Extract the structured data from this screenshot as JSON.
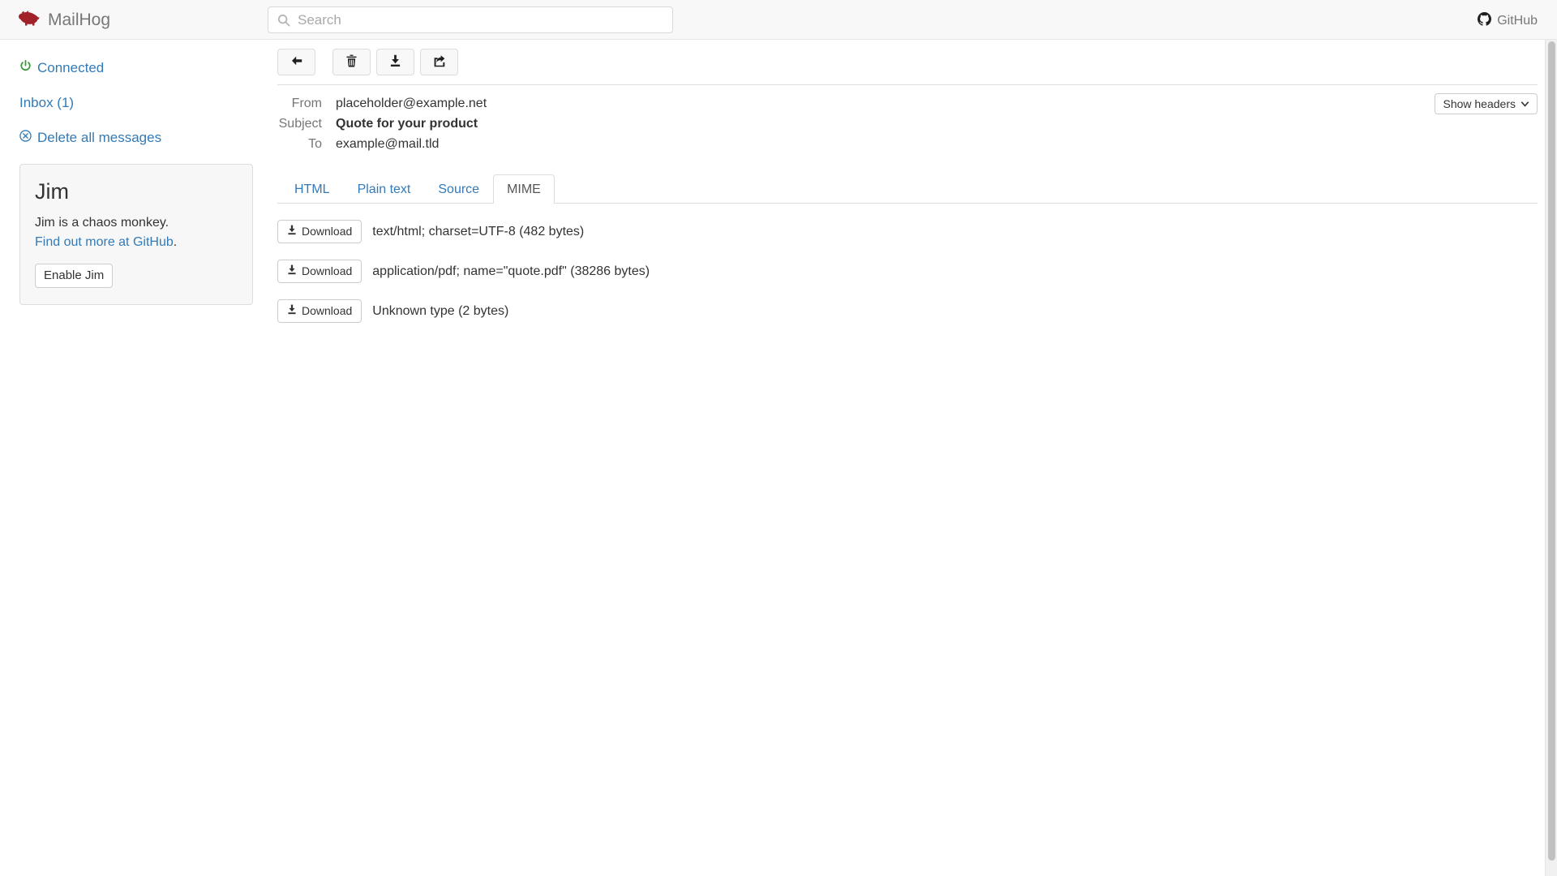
{
  "app": {
    "brand": "MailHog",
    "brand_logo_icon": "pig-icon",
    "brand_color": "#a02128"
  },
  "header": {
    "search": {
      "icon": "search-icon",
      "placeholder": "Search",
      "value": ""
    },
    "github": {
      "label": "GitHub",
      "icon": "github-icon"
    }
  },
  "sidebar": {
    "status": {
      "icon": "power-icon",
      "label": "Connected",
      "color": "#3c9a3c"
    },
    "inbox": {
      "label": "Inbox (1)"
    },
    "delete_all": {
      "icon": "x-circle-icon",
      "label": "Delete all messages"
    },
    "jim_panel": {
      "title": "Jim",
      "description": "Jim is a chaos monkey.",
      "link_label": "Find out more at GitHub",
      "link_suffix": ".",
      "button_label": "Enable Jim"
    }
  },
  "toolbar": {
    "buttons": [
      {
        "name": "back-button",
        "icon": "arrow-left-icon"
      },
      {
        "name": "delete-button",
        "icon": "trash-icon"
      },
      {
        "name": "download-button",
        "icon": "download-icon"
      },
      {
        "name": "release-button",
        "icon": "release-icon"
      }
    ]
  },
  "message": {
    "headers": [
      {
        "label": "From",
        "value": "placeholder@example.net",
        "bold": false
      },
      {
        "label": "Subject",
        "value": "Quote for your product",
        "bold": true
      },
      {
        "label": "To",
        "value": "example@mail.tld",
        "bold": false
      }
    ],
    "show_headers": {
      "label": "Show headers",
      "icon": "chevron-down-icon"
    },
    "tabs": [
      {
        "label": "HTML",
        "active": false
      },
      {
        "label": "Plain text",
        "active": false
      },
      {
        "label": "Source",
        "active": false
      },
      {
        "label": "MIME",
        "active": true
      }
    ],
    "mime_parts": [
      {
        "download_label": "Download",
        "description": "text/html; charset=UTF-8 (482 bytes)"
      },
      {
        "download_label": "Download",
        "description": "application/pdf; name=\"quote.pdf\" (38286 bytes)"
      },
      {
        "download_label": "Download",
        "description": "Unknown type (2 bytes)"
      }
    ]
  }
}
